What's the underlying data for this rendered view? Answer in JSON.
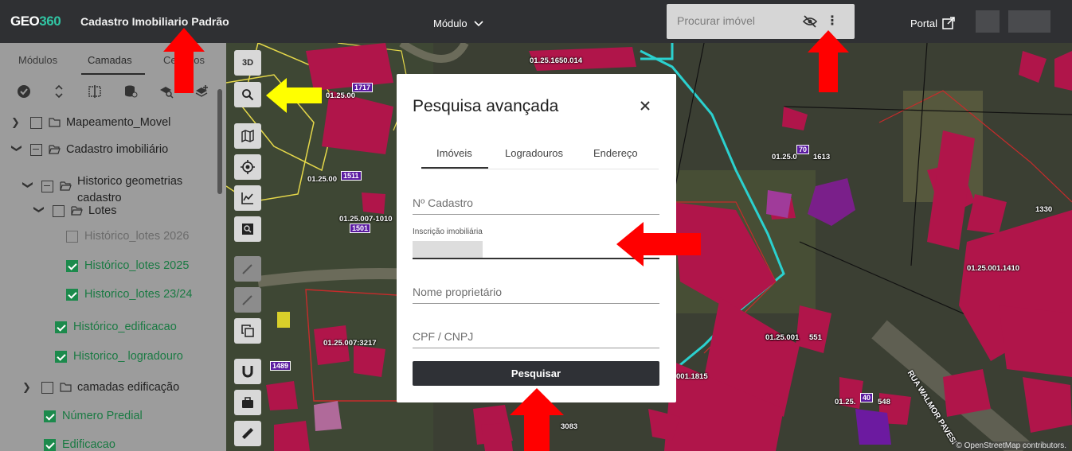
{
  "header": {
    "logo_geo": "GEO",
    "logo_num": "360",
    "app_title": "Cadastro Imobiliario Padrão",
    "module_label": "Módulo",
    "search_placeholder": "Procurar imóvel",
    "portal_label": "Portal"
  },
  "sidebar": {
    "tabs": [
      "Módulos",
      "Camadas",
      "Cenários"
    ],
    "active_tab": "Camadas",
    "tree": {
      "mapeamento_movel": "Mapeamento_Movel",
      "cadastro_imobiliario": "Cadastro imobiliário",
      "historico_geometrias": "Historico geometrias",
      "historico_geometrias_2": "cadastro",
      "lotes": "Lotes",
      "lotes_2026": "Histórico_lotes 2026",
      "lotes_2025": "Histórico_lotes 2025",
      "lotes_2324": "Historico_lotes 23/24",
      "edificacao": "Histórico_edificacao",
      "logradouro": "Historico_ logradouro",
      "camadas_edificacao": "camadas edificação",
      "numero_predial": "Número Predial",
      "edificacao2": "Edificacao"
    }
  },
  "map_tools": {
    "btn_3d": "3D"
  },
  "map": {
    "labels": {
      "l1": "01.25.1650.014",
      "l2": "1717",
      "l3": "01.25.00",
      "l4": "01.25.00",
      "l5": "1511",
      "l6": "01.25.007-1010",
      "l7": "1501",
      "l8": "70",
      "l9": "01.25.0",
      "l10": "1613",
      "l11": "01.25.007:3217",
      "l12": "1489",
      "l13": "001.1815",
      "l14": "01.25.001",
      "l15": "1330",
      "l16": "01.25.001.1410",
      "l17": "01.25.001",
      "l18": "551",
      "l19": "40",
      "l20": "01.25.",
      "l21": "548",
      "l22": "RUA WALMOR PAVESI",
      "l23": "3083"
    },
    "attribution": "© OpenStreetMap contributors."
  },
  "modal": {
    "title": "Pesquisa avançada",
    "tabs": [
      "Imóveis",
      "Logradouros",
      "Endereço"
    ],
    "active_tab": "Imóveis",
    "fields": {
      "cadastro": "Nº Cadastro",
      "inscricao_label": "Inscrição imobiliária",
      "proprietario": "Nome proprietário",
      "cpf": "CPF / CNPJ"
    },
    "button": "Pesquisar"
  },
  "colors": {
    "arrow_red": "#ff0000",
    "arrow_yellow": "#ffff00",
    "check_green": "#1c8a4c",
    "building_crimson": "#b0154a"
  }
}
